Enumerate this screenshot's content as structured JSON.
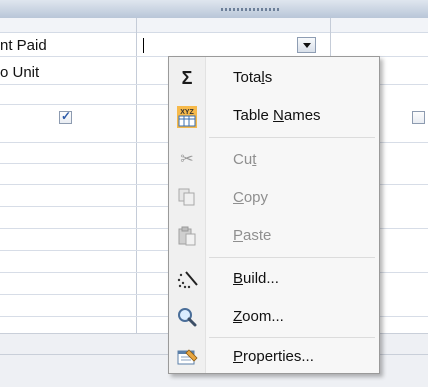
{
  "grid": {
    "row_field_1": "nt Paid",
    "row_field_2": "o Unit",
    "checkbox_checked": true
  },
  "context_menu": {
    "items": [
      {
        "label": "Totals",
        "icon": "sigma-icon",
        "enabled": true
      },
      {
        "label": "Table Names",
        "icon": "table-names-icon",
        "enabled": true
      },
      {
        "label": "Cut",
        "icon": "scissors-icon",
        "enabled": false
      },
      {
        "label": "Copy",
        "icon": "copy-icon",
        "enabled": false
      },
      {
        "label": "Paste",
        "icon": "paste-icon",
        "enabled": false
      },
      {
        "label": "Build...",
        "icon": "build-wand-icon",
        "enabled": true
      },
      {
        "label": "Zoom...",
        "icon": "magnifier-icon",
        "enabled": true
      },
      {
        "label": "Properties...",
        "icon": "properties-icon",
        "enabled": true
      }
    ]
  },
  "colors": {
    "menu_background": "#f7f7f7",
    "disabled_text": "#8f8f8f",
    "checkbox_tick": "#2c5aa8"
  }
}
